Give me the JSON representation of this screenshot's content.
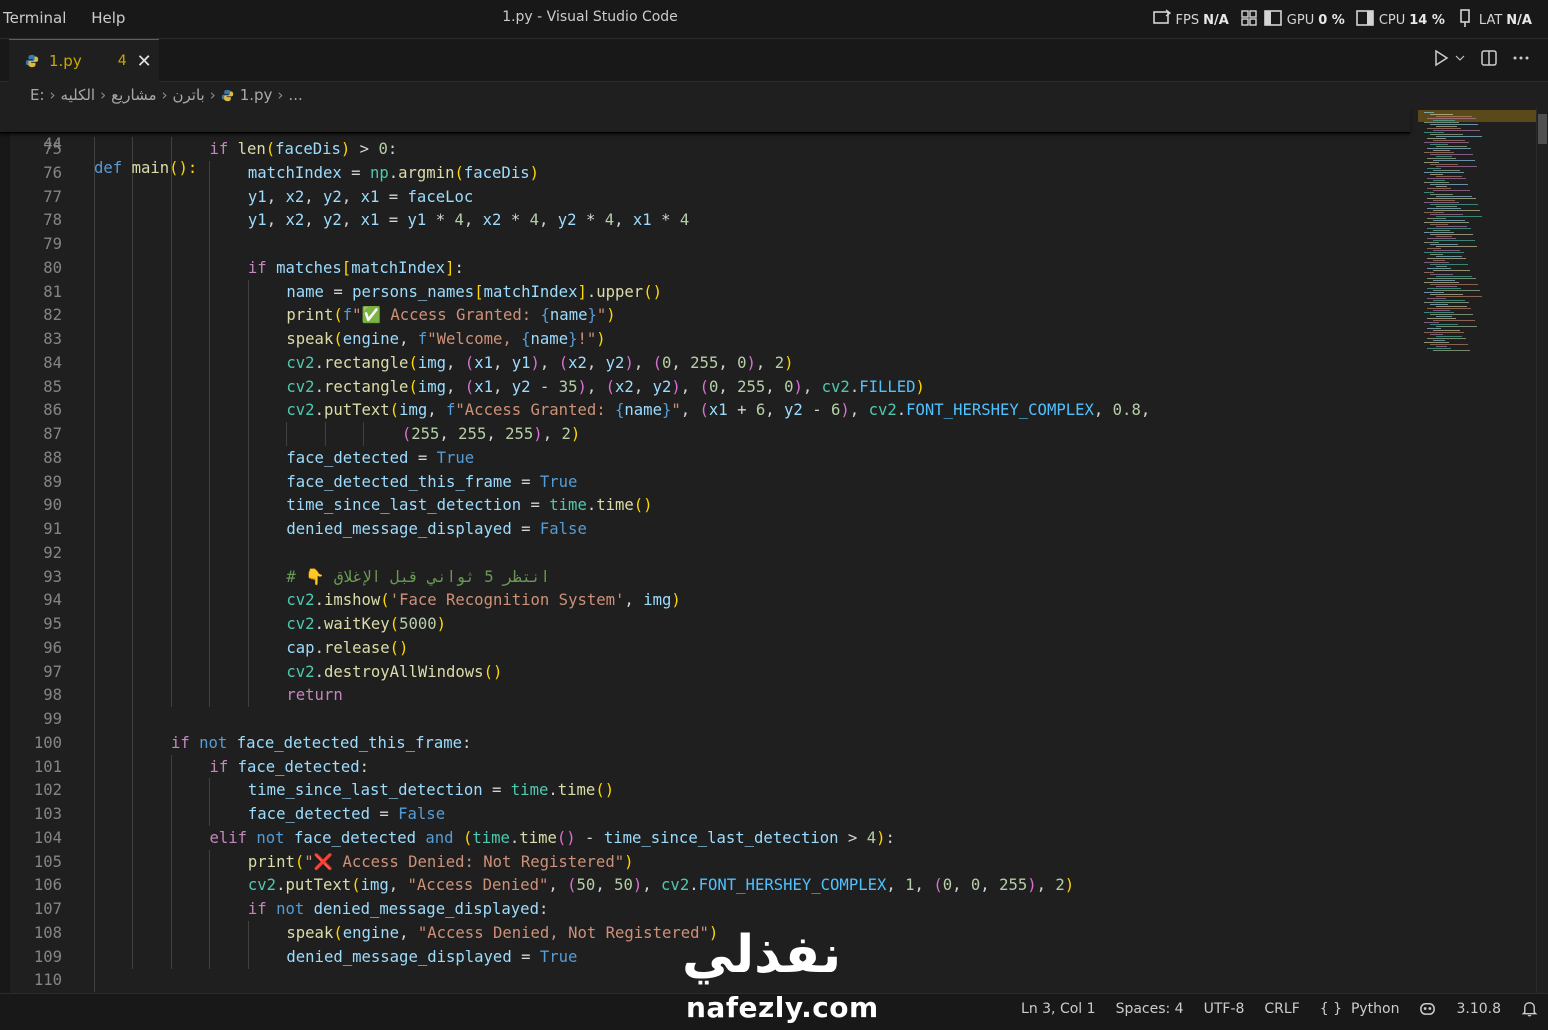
{
  "titlebar": {
    "menu": [
      "Terminal",
      "Help"
    ],
    "title": "1.py - Visual Studio Code",
    "stats": [
      {
        "label": "FPS",
        "value": "N/A"
      },
      {
        "label": "GPU",
        "value": "0 %"
      },
      {
        "label": "CPU",
        "value": "14 %"
      },
      {
        "label": "LAT",
        "value": "N/A"
      }
    ]
  },
  "tab": {
    "name": "1.py",
    "problems": "4",
    "close": "✕"
  },
  "breadcrumb": {
    "items": [
      "E:",
      "الكليه",
      "مشاريع",
      "باترن",
      "1.py",
      "..."
    ]
  },
  "editor": {
    "sticky": {
      "line_number": "44",
      "keyword": "def",
      "function": "main",
      "rest": "():"
    },
    "lines": [
      {
        "n": "75",
        "indent": 3
      },
      {
        "n": "76",
        "indent": 4
      },
      {
        "n": "77",
        "indent": 4
      },
      {
        "n": "78",
        "indent": 4
      },
      {
        "n": "79",
        "indent": 4
      },
      {
        "n": "80",
        "indent": 4
      },
      {
        "n": "81",
        "indent": 5
      },
      {
        "n": "82",
        "indent": 5
      },
      {
        "n": "83",
        "indent": 5
      },
      {
        "n": "84",
        "indent": 5
      },
      {
        "n": "85",
        "indent": 5
      },
      {
        "n": "86",
        "indent": 5
      },
      {
        "n": "87",
        "indent": 8
      },
      {
        "n": "88",
        "indent": 5
      },
      {
        "n": "89",
        "indent": 5
      },
      {
        "n": "90",
        "indent": 5
      },
      {
        "n": "91",
        "indent": 5
      },
      {
        "n": "92",
        "indent": 5
      },
      {
        "n": "93",
        "indent": 5
      },
      {
        "n": "94",
        "indent": 5
      },
      {
        "n": "95",
        "indent": 5
      },
      {
        "n": "96",
        "indent": 5
      },
      {
        "n": "97",
        "indent": 5
      },
      {
        "n": "98",
        "indent": 5
      },
      {
        "n": "99",
        "indent": 2
      },
      {
        "n": "100",
        "indent": 2
      },
      {
        "n": "101",
        "indent": 3
      },
      {
        "n": "102",
        "indent": 4
      },
      {
        "n": "103",
        "indent": 4
      },
      {
        "n": "104",
        "indent": 3
      },
      {
        "n": "105",
        "indent": 4
      },
      {
        "n": "106",
        "indent": 4
      },
      {
        "n": "107",
        "indent": 4
      },
      {
        "n": "108",
        "indent": 5
      },
      {
        "n": "109",
        "indent": 5
      },
      {
        "n": "110",
        "indent": 1
      }
    ],
    "tokens": [
      [
        [
          "kw",
          "if "
        ],
        [
          "fn",
          "len"
        ],
        [
          "br1",
          "("
        ],
        [
          "var",
          "faceDis"
        ],
        [
          "br1",
          ")"
        ],
        [
          "op",
          " > "
        ],
        [
          "num",
          "0"
        ],
        [
          "op",
          ":"
        ]
      ],
      [
        [
          "var",
          "matchIndex"
        ],
        [
          "op",
          " = "
        ],
        [
          "cls",
          "np"
        ],
        [
          "op",
          "."
        ],
        [
          "fn",
          "argmin"
        ],
        [
          "br1",
          "("
        ],
        [
          "var",
          "faceDis"
        ],
        [
          "br1",
          ")"
        ]
      ],
      [
        [
          "var",
          "y1"
        ],
        [
          "op",
          ", "
        ],
        [
          "var",
          "x2"
        ],
        [
          "op",
          ", "
        ],
        [
          "var",
          "y2"
        ],
        [
          "op",
          ", "
        ],
        [
          "var",
          "x1"
        ],
        [
          "op",
          " = "
        ],
        [
          "var",
          "faceLoc"
        ]
      ],
      [
        [
          "var",
          "y1"
        ],
        [
          "op",
          ", "
        ],
        [
          "var",
          "x2"
        ],
        [
          "op",
          ", "
        ],
        [
          "var",
          "y2"
        ],
        [
          "op",
          ", "
        ],
        [
          "var",
          "x1"
        ],
        [
          "op",
          " = "
        ],
        [
          "var",
          "y1"
        ],
        [
          "op",
          " * "
        ],
        [
          "num",
          "4"
        ],
        [
          "op",
          ", "
        ],
        [
          "var",
          "x2"
        ],
        [
          "op",
          " * "
        ],
        [
          "num",
          "4"
        ],
        [
          "op",
          ", "
        ],
        [
          "var",
          "y2"
        ],
        [
          "op",
          " * "
        ],
        [
          "num",
          "4"
        ],
        [
          "op",
          ", "
        ],
        [
          "var",
          "x1"
        ],
        [
          "op",
          " * "
        ],
        [
          "num",
          "4"
        ]
      ],
      [],
      [
        [
          "kw",
          "if "
        ],
        [
          "var",
          "matches"
        ],
        [
          "br1",
          "["
        ],
        [
          "var",
          "matchIndex"
        ],
        [
          "br1",
          "]"
        ],
        [
          "op",
          ":"
        ]
      ],
      [
        [
          "var",
          "name"
        ],
        [
          "op",
          " = "
        ],
        [
          "var",
          "persons_names"
        ],
        [
          "br1",
          "["
        ],
        [
          "var",
          "matchIndex"
        ],
        [
          "br1",
          "]"
        ],
        [
          "op",
          "."
        ],
        [
          "fn",
          "upper"
        ],
        [
          "br1",
          "()"
        ]
      ],
      [
        [
          "fn",
          "print"
        ],
        [
          "br1",
          "("
        ],
        [
          "kd",
          "f"
        ],
        [
          "str",
          "\"✅ Access Granted: "
        ],
        [
          "kd",
          "{"
        ],
        [
          "var",
          "name"
        ],
        [
          "kd",
          "}"
        ],
        [
          "str",
          "\""
        ],
        [
          "br1",
          ")"
        ]
      ],
      [
        [
          "fn",
          "speak"
        ],
        [
          "br1",
          "("
        ],
        [
          "var",
          "engine"
        ],
        [
          "op",
          ", "
        ],
        [
          "kd",
          "f"
        ],
        [
          "str",
          "\"Welcome, "
        ],
        [
          "kd",
          "{"
        ],
        [
          "var",
          "name"
        ],
        [
          "kd",
          "}"
        ],
        [
          "str",
          "!\""
        ],
        [
          "br1",
          ")"
        ]
      ],
      [
        [
          "cls",
          "cv2"
        ],
        [
          "op",
          "."
        ],
        [
          "fn",
          "rectangle"
        ],
        [
          "br1",
          "("
        ],
        [
          "var",
          "img"
        ],
        [
          "op",
          ", "
        ],
        [
          "br2",
          "("
        ],
        [
          "var",
          "x1"
        ],
        [
          "op",
          ", "
        ],
        [
          "var",
          "y1"
        ],
        [
          "br2",
          ")"
        ],
        [
          "op",
          ", "
        ],
        [
          "br2",
          "("
        ],
        [
          "var",
          "x2"
        ],
        [
          "op",
          ", "
        ],
        [
          "var",
          "y2"
        ],
        [
          "br2",
          ")"
        ],
        [
          "op",
          ", "
        ],
        [
          "br2",
          "("
        ],
        [
          "num",
          "0"
        ],
        [
          "op",
          ", "
        ],
        [
          "num",
          "255"
        ],
        [
          "op",
          ", "
        ],
        [
          "num",
          "0"
        ],
        [
          "br2",
          ")"
        ],
        [
          "op",
          ", "
        ],
        [
          "num",
          "2"
        ],
        [
          "br1",
          ")"
        ]
      ],
      [
        [
          "cls",
          "cv2"
        ],
        [
          "op",
          "."
        ],
        [
          "fn",
          "rectangle"
        ],
        [
          "br1",
          "("
        ],
        [
          "var",
          "img"
        ],
        [
          "op",
          ", "
        ],
        [
          "br2",
          "("
        ],
        [
          "var",
          "x1"
        ],
        [
          "op",
          ", "
        ],
        [
          "var",
          "y2"
        ],
        [
          "op",
          " - "
        ],
        [
          "num",
          "35"
        ],
        [
          "br2",
          ")"
        ],
        [
          "op",
          ", "
        ],
        [
          "br2",
          "("
        ],
        [
          "var",
          "x2"
        ],
        [
          "op",
          ", "
        ],
        [
          "var",
          "y2"
        ],
        [
          "br2",
          ")"
        ],
        [
          "op",
          ", "
        ],
        [
          "br2",
          "("
        ],
        [
          "num",
          "0"
        ],
        [
          "op",
          ", "
        ],
        [
          "num",
          "255"
        ],
        [
          "op",
          ", "
        ],
        [
          "num",
          "0"
        ],
        [
          "br2",
          ")"
        ],
        [
          "op",
          ", "
        ],
        [
          "cls",
          "cv2"
        ],
        [
          "op",
          "."
        ],
        [
          "const",
          "FILLED"
        ],
        [
          "br1",
          ")"
        ]
      ],
      [
        [
          "cls",
          "cv2"
        ],
        [
          "op",
          "."
        ],
        [
          "fn",
          "putText"
        ],
        [
          "br1",
          "("
        ],
        [
          "var",
          "img"
        ],
        [
          "op",
          ", "
        ],
        [
          "kd",
          "f"
        ],
        [
          "str",
          "\"Access Granted: "
        ],
        [
          "kd",
          "{"
        ],
        [
          "var",
          "name"
        ],
        [
          "kd",
          "}"
        ],
        [
          "str",
          "\""
        ],
        [
          "op",
          ", "
        ],
        [
          "br2",
          "("
        ],
        [
          "var",
          "x1"
        ],
        [
          "op",
          " + "
        ],
        [
          "num",
          "6"
        ],
        [
          "op",
          ", "
        ],
        [
          "var",
          "y2"
        ],
        [
          "op",
          " - "
        ],
        [
          "num",
          "6"
        ],
        [
          "br2",
          ")"
        ],
        [
          "op",
          ", "
        ],
        [
          "cls",
          "cv2"
        ],
        [
          "op",
          "."
        ],
        [
          "const",
          "FONT_HERSHEY_COMPLEX"
        ],
        [
          "op",
          ", "
        ],
        [
          "num",
          "0.8"
        ],
        [
          "op",
          ","
        ]
      ],
      [
        [
          "br2",
          "("
        ],
        [
          "num",
          "255"
        ],
        [
          "op",
          ", "
        ],
        [
          "num",
          "255"
        ],
        [
          "op",
          ", "
        ],
        [
          "num",
          "255"
        ],
        [
          "br2",
          ")"
        ],
        [
          "op",
          ", "
        ],
        [
          "num",
          "2"
        ],
        [
          "br1",
          ")"
        ]
      ],
      [
        [
          "var",
          "face_detected"
        ],
        [
          "op",
          " = "
        ],
        [
          "bool",
          "True"
        ]
      ],
      [
        [
          "var",
          "face_detected_this_frame"
        ],
        [
          "op",
          " = "
        ],
        [
          "bool",
          "True"
        ]
      ],
      [
        [
          "var",
          "time_since_last_detection"
        ],
        [
          "op",
          " = "
        ],
        [
          "cls",
          "time"
        ],
        [
          "op",
          "."
        ],
        [
          "fn",
          "time"
        ],
        [
          "br1",
          "()"
        ]
      ],
      [
        [
          "var",
          "denied_message_displayed"
        ],
        [
          "op",
          " = "
        ],
        [
          "bool",
          "False"
        ]
      ],
      [],
      [
        [
          "cmt",
          "# 👇 انتظر 5 ثواني قبل الإغلاق"
        ]
      ],
      [
        [
          "cls",
          "cv2"
        ],
        [
          "op",
          "."
        ],
        [
          "fn",
          "imshow"
        ],
        [
          "br1",
          "("
        ],
        [
          "str",
          "'Face Recognition System'"
        ],
        [
          "op",
          ", "
        ],
        [
          "var",
          "img"
        ],
        [
          "br1",
          ")"
        ]
      ],
      [
        [
          "cls",
          "cv2"
        ],
        [
          "op",
          "."
        ],
        [
          "fn",
          "waitKey"
        ],
        [
          "br1",
          "("
        ],
        [
          "num",
          "5000"
        ],
        [
          "br1",
          ")"
        ]
      ],
      [
        [
          "var",
          "cap"
        ],
        [
          "op",
          "."
        ],
        [
          "fn",
          "release"
        ],
        [
          "br1",
          "()"
        ]
      ],
      [
        [
          "cls",
          "cv2"
        ],
        [
          "op",
          "."
        ],
        [
          "fn",
          "destroyAllWindows"
        ],
        [
          "br1",
          "()"
        ]
      ],
      [
        [
          "kw",
          "return"
        ]
      ],
      [],
      [
        [
          "kw",
          "if "
        ],
        [
          "kd",
          "not "
        ],
        [
          "var",
          "face_detected_this_frame"
        ],
        [
          "op",
          ":"
        ]
      ],
      [
        [
          "kw",
          "if "
        ],
        [
          "var",
          "face_detected"
        ],
        [
          "op",
          ":"
        ]
      ],
      [
        [
          "var",
          "time_since_last_detection"
        ],
        [
          "op",
          " = "
        ],
        [
          "cls",
          "time"
        ],
        [
          "op",
          "."
        ],
        [
          "fn",
          "time"
        ],
        [
          "br1",
          "()"
        ]
      ],
      [
        [
          "var",
          "face_detected"
        ],
        [
          "op",
          " = "
        ],
        [
          "bool",
          "False"
        ]
      ],
      [
        [
          "kw",
          "elif "
        ],
        [
          "kd",
          "not "
        ],
        [
          "var",
          "face_detected"
        ],
        [
          "kd",
          " and "
        ],
        [
          "br1",
          "("
        ],
        [
          "cls",
          "time"
        ],
        [
          "op",
          "."
        ],
        [
          "fn",
          "time"
        ],
        [
          "br2",
          "()"
        ],
        [
          "op",
          " - "
        ],
        [
          "var",
          "time_since_last_detection"
        ],
        [
          "op",
          " > "
        ],
        [
          "num",
          "4"
        ],
        [
          "br1",
          ")"
        ],
        [
          "op",
          ":"
        ]
      ],
      [
        [
          "fn",
          "print"
        ],
        [
          "br1",
          "("
        ],
        [
          "str",
          "\"❌ Access Denied: Not Registered\""
        ],
        [
          "br1",
          ")"
        ]
      ],
      [
        [
          "cls",
          "cv2"
        ],
        [
          "op",
          "."
        ],
        [
          "fn",
          "putText"
        ],
        [
          "br1",
          "("
        ],
        [
          "var",
          "img"
        ],
        [
          "op",
          ", "
        ],
        [
          "str",
          "\"Access Denied\""
        ],
        [
          "op",
          ", "
        ],
        [
          "br2",
          "("
        ],
        [
          "num",
          "50"
        ],
        [
          "op",
          ", "
        ],
        [
          "num",
          "50"
        ],
        [
          "br2",
          ")"
        ],
        [
          "op",
          ", "
        ],
        [
          "cls",
          "cv2"
        ],
        [
          "op",
          "."
        ],
        [
          "const",
          "FONT_HERSHEY_COMPLEX"
        ],
        [
          "op",
          ", "
        ],
        [
          "num",
          "1"
        ],
        [
          "op",
          ", "
        ],
        [
          "br2",
          "("
        ],
        [
          "num",
          "0"
        ],
        [
          "op",
          ", "
        ],
        [
          "num",
          "0"
        ],
        [
          "op",
          ", "
        ],
        [
          "num",
          "255"
        ],
        [
          "br2",
          ")"
        ],
        [
          "op",
          ", "
        ],
        [
          "num",
          "2"
        ],
        [
          "br1",
          ")"
        ]
      ],
      [
        [
          "kw",
          "if "
        ],
        [
          "kd",
          "not "
        ],
        [
          "var",
          "denied_message_displayed"
        ],
        [
          "op",
          ":"
        ]
      ],
      [
        [
          "fn",
          "speak"
        ],
        [
          "br1",
          "("
        ],
        [
          "var",
          "engine"
        ],
        [
          "op",
          ", "
        ],
        [
          "str",
          "\"Access Denied, Not Registered\""
        ],
        [
          "br1",
          ")"
        ]
      ],
      [
        [
          "var",
          "denied_message_displayed"
        ],
        [
          "op",
          " = "
        ],
        [
          "bool",
          "True"
        ]
      ],
      []
    ]
  },
  "statusbar": {
    "position": "Ln 3, Col 1",
    "spaces": "Spaces: 4",
    "encoding": "UTF-8",
    "eol": "CRLF",
    "language_braces": "{ }",
    "language": "Python",
    "python_version": "3.10.8"
  },
  "watermark": {
    "arabic": "نفذلي",
    "latin": "nafezly.com"
  }
}
